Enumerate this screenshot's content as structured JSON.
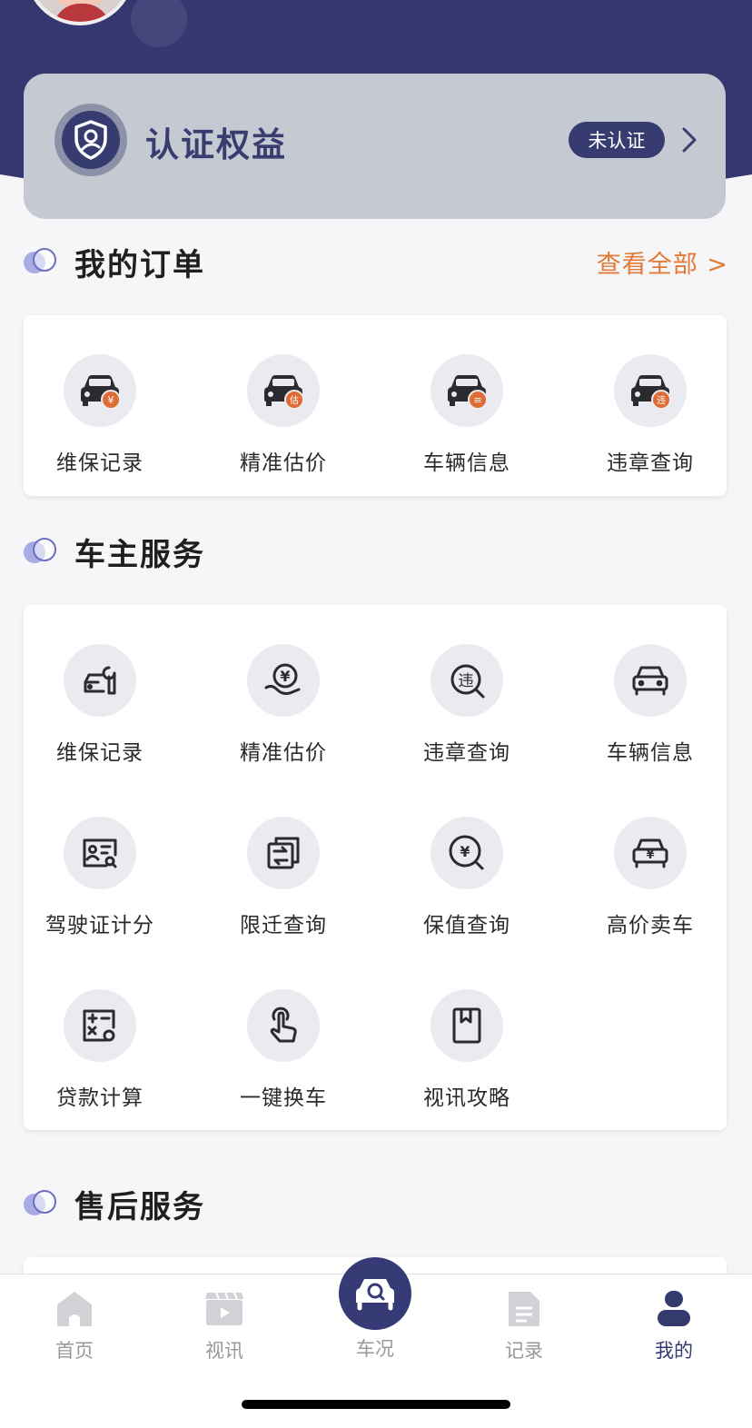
{
  "certification": {
    "title": "认证权益",
    "status_badge": "未认证"
  },
  "orders": {
    "title": "我的订单",
    "view_all": "查看全部 >",
    "items": [
      {
        "label": "维保记录",
        "icon": "car-wrench-badge-icon"
      },
      {
        "label": "精准估价",
        "icon": "car-estimate-badge-icon"
      },
      {
        "label": "车辆信息",
        "icon": "car-info-badge-icon"
      },
      {
        "label": "违章查询",
        "icon": "car-violation-badge-icon"
      }
    ],
    "badge_texts": [
      "¥",
      "估",
      "≡",
      "违"
    ]
  },
  "owner_services": {
    "title": "车主服务",
    "items": [
      {
        "label": "维保记录",
        "icon": "car-wrench-icon"
      },
      {
        "label": "精准估价",
        "icon": "yen-hand-icon"
      },
      {
        "label": "违章查询",
        "icon": "violation-search-icon"
      },
      {
        "label": "车辆信息",
        "icon": "car-front-icon"
      },
      {
        "label": "驾驶证计分",
        "icon": "license-card-icon"
      },
      {
        "label": "限迁查询",
        "icon": "transfer-icon"
      },
      {
        "label": "保值查询",
        "icon": "yen-search-icon"
      },
      {
        "label": "高价卖车",
        "icon": "car-yen-icon"
      },
      {
        "label": "贷款计算",
        "icon": "calculator-icon"
      },
      {
        "label": "一键换车",
        "icon": "tap-hand-icon"
      },
      {
        "label": "视讯攻略",
        "icon": "bookmark-book-icon"
      }
    ],
    "glyphs": {
      "yen": "¥",
      "violation": "违"
    }
  },
  "after_sales": {
    "title": "售后服务"
  },
  "tabbar": {
    "tabs": [
      {
        "label": "首页",
        "icon": "home-icon",
        "active": false
      },
      {
        "label": "视讯",
        "icon": "video-icon",
        "active": false
      },
      {
        "label": "车况",
        "icon": "car-search-icon",
        "active": false
      },
      {
        "label": "记录",
        "icon": "document-icon",
        "active": false
      },
      {
        "label": "我的",
        "icon": "person-icon",
        "active": true
      }
    ]
  },
  "colors": {
    "header": "#353870",
    "accent": "#363b70",
    "badge_orange": "#e06c35",
    "link_orange": "#e07a36"
  }
}
